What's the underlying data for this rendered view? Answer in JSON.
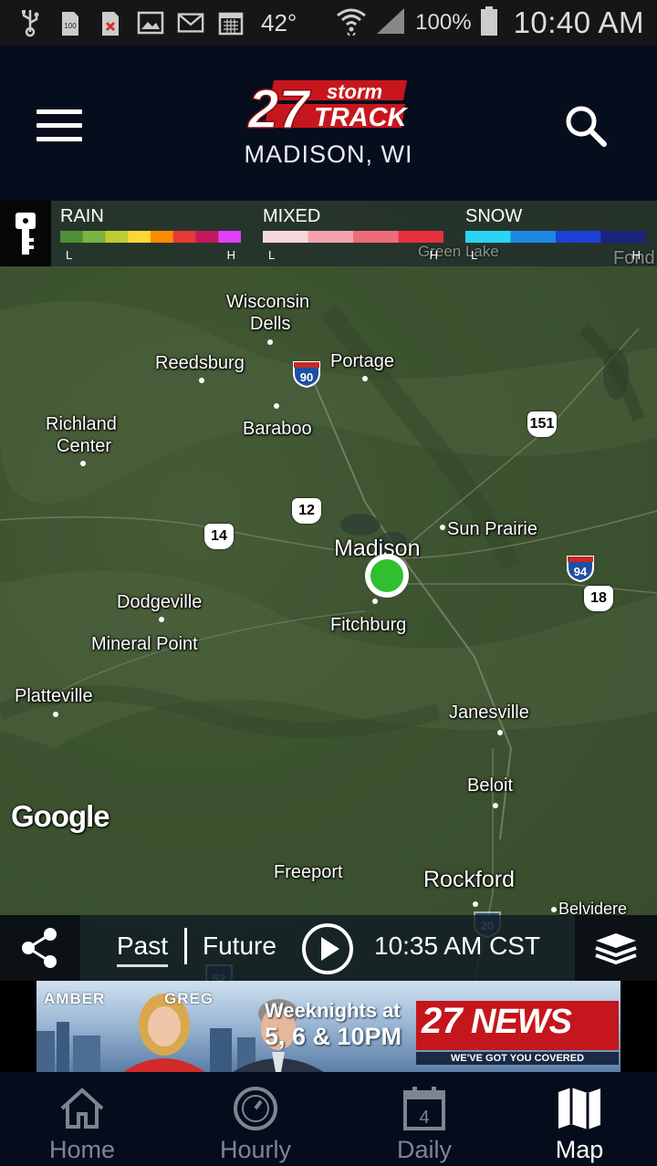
{
  "status_bar": {
    "icons": [
      "usb-icon",
      "storage-100-icon",
      "sim-error-icon",
      "gallery-icon",
      "gmail-icon",
      "calendar-icon",
      "wifi-icon",
      "signal-icon",
      "battery-icon"
    ],
    "temperature": "42°",
    "battery": "100%",
    "time": "10:40 AM"
  },
  "header": {
    "logo_number": "27",
    "logo_storm": "storm",
    "logo_track": "TRACK",
    "location": "MADISON, WI"
  },
  "legend": {
    "groups": [
      {
        "label": "RAIN",
        "low": "L",
        "high": "H",
        "colors": [
          "#4f8f3a",
          "#7cb342",
          "#c0ca33",
          "#fdd835",
          "#fb8c00",
          "#e53935",
          "#c2185b",
          "#e040fb"
        ]
      },
      {
        "label": "MIXED",
        "low": "L",
        "high": "H",
        "colors": [
          "#f8d7dc",
          "#f4a3ad",
          "#ef6b78",
          "#e8303f"
        ]
      },
      {
        "label": "SNOW",
        "low": "L",
        "high": "H",
        "colors": [
          "#29d4f5",
          "#1e88e5",
          "#1e3fd8",
          "#1a237e"
        ]
      }
    ]
  },
  "map": {
    "cities": [
      {
        "name": "Wisconsin"
      },
      {
        "name": "Dells"
      },
      {
        "name": "Reedsburg"
      },
      {
        "name": "Portage"
      },
      {
        "name": "Richland"
      },
      {
        "name": "Center"
      },
      {
        "name": "Baraboo"
      },
      {
        "name": "Sun Prairie"
      },
      {
        "name": "Madison"
      },
      {
        "name": "Dodgeville"
      },
      {
        "name": "Fitchburg"
      },
      {
        "name": "Mineral Point"
      },
      {
        "name": "Platteville"
      },
      {
        "name": "Janesville"
      },
      {
        "name": "Beloit"
      },
      {
        "name": "Freeport"
      },
      {
        "name": "Rockford"
      },
      {
        "name": "Belvidere"
      }
    ],
    "faint_labels": [
      "Green Lake",
      "Fond"
    ],
    "highways": {
      "i90": "90",
      "us151": "151",
      "us12": "12",
      "us14": "14",
      "i94": "94",
      "us18": "18",
      "i20": "20",
      "i52": "52"
    },
    "attribution": "Google"
  },
  "playback": {
    "past_label": "Past",
    "future_label": "Future",
    "time": "10:35 AM CST"
  },
  "ad": {
    "name_left": "AMBER",
    "name_right": "GREG",
    "schedule_line1": "Weeknights at",
    "schedule_line2": "5, 6 & 10PM",
    "brand_number": "27",
    "brand_word": "NEWS",
    "tagline": "WE'VE GOT YOU COVERED"
  },
  "bottom_nav": {
    "items": [
      {
        "label": "Home",
        "icon": "home-icon"
      },
      {
        "label": "Hourly",
        "icon": "clock-icon"
      },
      {
        "label": "Daily",
        "icon": "calendar-day-icon",
        "badge": "4"
      },
      {
        "label": "Map",
        "icon": "map-icon",
        "active": true
      }
    ]
  }
}
